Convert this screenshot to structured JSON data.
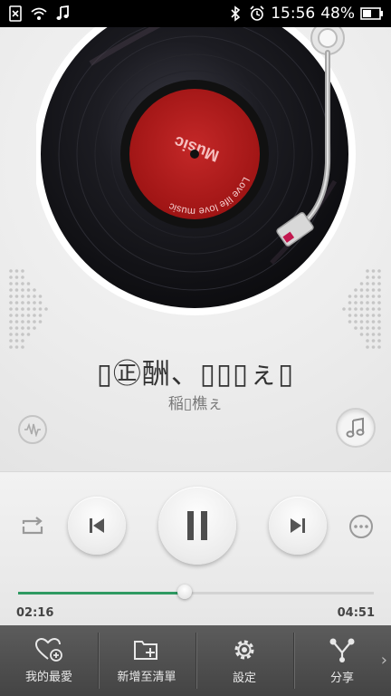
{
  "status_bar": {
    "time": "15:56",
    "battery": "48%"
  },
  "record": {
    "label_title": "Music",
    "label_subtitle": "Love life love music"
  },
  "song": {
    "title": "▯㊣酬、▯▯▯ぇ▯",
    "artist": "稲▯樵ぇ"
  },
  "progress": {
    "elapsed": "02:16",
    "total": "04:51",
    "fraction": 0.468
  },
  "tabs": [
    {
      "label": "我的最愛",
      "icon": "heart-plus-icon"
    },
    {
      "label": "新增至清單",
      "icon": "folder-plus-icon"
    },
    {
      "label": "設定",
      "icon": "gear-icon"
    },
    {
      "label": "分享",
      "icon": "share-icon"
    }
  ],
  "colors": {
    "accent": "#2f9a62",
    "label_red": "#b71c1c",
    "tabbar": "#4f4f4f"
  }
}
